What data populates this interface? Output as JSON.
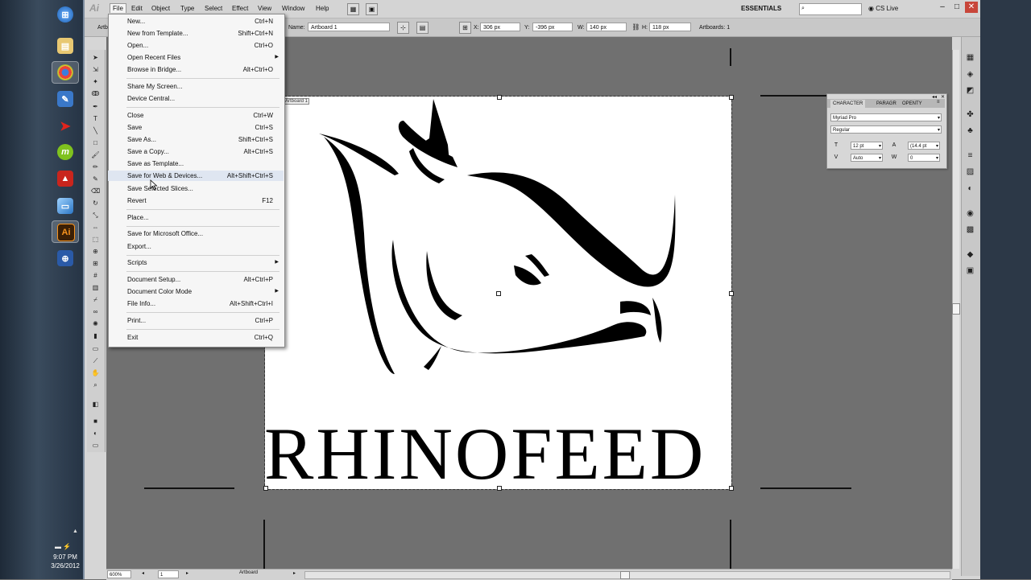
{
  "taskbar": {
    "icons": [
      "windows-orb-icon",
      "library-icon",
      "chrome-icon",
      "notes-icon",
      "red-arrow-icon",
      "m-app-icon",
      "acrobat-icon",
      "window-icon",
      "illustrator-icon",
      "network-icon"
    ],
    "illustrator_label": "Ai",
    "m_label": "m",
    "clock_time": "9:07 PM",
    "clock_date": "3/26/2012"
  },
  "app": {
    "logo": "Ai",
    "menus": [
      "File",
      "Edit",
      "Object",
      "Type",
      "Select",
      "Effect",
      "View",
      "Window",
      "Help"
    ],
    "workspace": "ESSENTIALS",
    "cs_live": "CS Live"
  },
  "control_bar": {
    "name_label": "Name:",
    "name_value": "Artboard 1",
    "x_label": "X:",
    "x_value": "306 px",
    "y_label": "Y:",
    "y_value": "-396 px",
    "w_label": "W:",
    "w_value": "140 px",
    "h_label": "H:",
    "h_value": "118 px",
    "artboards_label": "Artboards: 1",
    "left_partial": "Artb"
  },
  "file_menu": {
    "items": [
      {
        "label": "New...",
        "shortcut": "Ctrl+N"
      },
      {
        "label": "New from Template...",
        "shortcut": "Shift+Ctrl+N"
      },
      {
        "label": "Open...",
        "shortcut": "Ctrl+O"
      },
      {
        "label": "Open Recent Files",
        "shortcut": ""
      },
      {
        "label": "Browse in Bridge...",
        "shortcut": "Alt+Ctrl+O"
      },
      {
        "label": "Share My Screen...",
        "shortcut": ""
      },
      {
        "label": "Device Central...",
        "shortcut": ""
      },
      {
        "label": "Close",
        "shortcut": "Ctrl+W"
      },
      {
        "label": "Save",
        "shortcut": "Ctrl+S"
      },
      {
        "label": "Save As...",
        "shortcut": "Shift+Ctrl+S"
      },
      {
        "label": "Save a Copy...",
        "shortcut": "Alt+Ctrl+S"
      },
      {
        "label": "Save as Template...",
        "shortcut": ""
      },
      {
        "label": "Save for Web & Devices...",
        "shortcut": "Alt+Shift+Ctrl+S"
      },
      {
        "label": "Save Selected Slices...",
        "shortcut": ""
      },
      {
        "label": "Revert",
        "shortcut": "F12"
      },
      {
        "label": "Place...",
        "shortcut": ""
      },
      {
        "label": "Save for Microsoft Office...",
        "shortcut": ""
      },
      {
        "label": "Export...",
        "shortcut": ""
      },
      {
        "label": "Scripts",
        "shortcut": ""
      },
      {
        "label": "Document Setup...",
        "shortcut": "Alt+Ctrl+P"
      },
      {
        "label": "Document Color Mode",
        "shortcut": ""
      },
      {
        "label": "File Info...",
        "shortcut": "Alt+Shift+Ctrl+I"
      },
      {
        "label": "Print...",
        "shortcut": "Ctrl+P"
      },
      {
        "label": "Exit",
        "shortcut": "Ctrl+Q"
      }
    ]
  },
  "artboard": {
    "tag": "Artboard 1",
    "brand_text": "RHINOFEED"
  },
  "character_panel": {
    "tabs": [
      "CHARACTER",
      "PARAGR",
      "OPENTY"
    ],
    "font_family": "Myriad Pro",
    "font_style": "Regular",
    "font_size": "12 pt",
    "leading": "(14.4 pt",
    "kerning": "Auto",
    "tracking": "0"
  },
  "status_bar": {
    "zoom": "600%",
    "page": "1",
    "status": "Artboard"
  }
}
